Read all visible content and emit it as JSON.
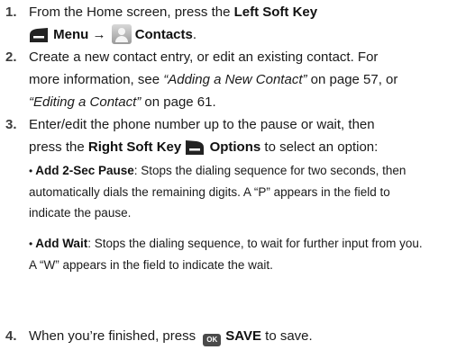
{
  "steps": [
    {
      "number": "1.",
      "line1": "From the Home screen, press the ",
      "left_soft_key": "Left Soft Key",
      "menu": "Menu",
      "arrow": "→",
      "contacts": "Contacts",
      "period": "."
    },
    {
      "number": "2.",
      "line1": "Create a new contact entry, or edit an existing contact. For",
      "line2a": "more information, see ",
      "link1": "“Adding a New Contact”",
      "line2b": " on page 57, or",
      "link2": "“Editing a Contact”",
      "line3b": " on page 61."
    },
    {
      "number": "3.",
      "line1": "Enter/edit the phone number up to the pause or wait, then",
      "line2a": "press the ",
      "right_soft_key": "Right Soft Key",
      "options": "Options",
      "line2b": " to select an option:",
      "bullets": [
        {
          "term": "Add 2-Sec Pause",
          "line1": ": Stops the dialing sequence for two seconds, then",
          "line2": "automatically dials the remaining digits. A “P” appears in the field to",
          "line3": "indicate the pause."
        },
        {
          "term": "Add Wait",
          "line1": ": Stops the dialing sequence, to wait for further input from you.",
          "line2": "A “W” appears in the field to indicate the wait."
        }
      ]
    },
    {
      "number": "4.",
      "line1": "When you’re finished, press ",
      "ok_label": "OK",
      "save": "SAVE",
      "line1b": " to save."
    }
  ]
}
